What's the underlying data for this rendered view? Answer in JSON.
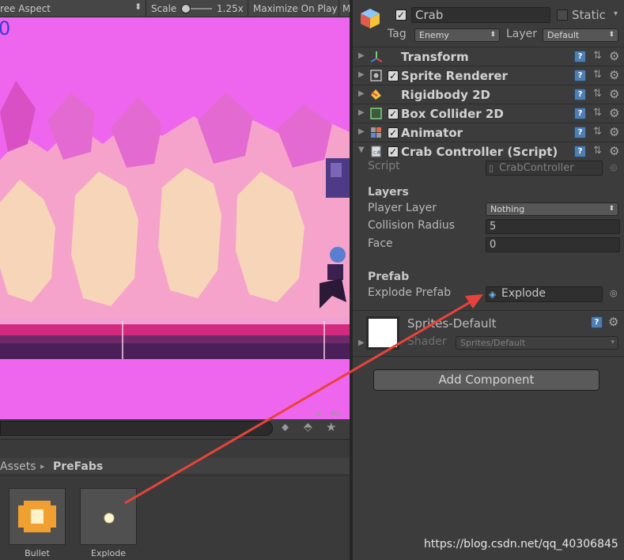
{
  "game_view": {
    "aspect_label": "ree Aspect",
    "scale_label": "Scale",
    "scale_value": "1.25x",
    "maximize_label": "Maximize On Play",
    "corner_text": "0"
  },
  "project": {
    "breadcrumb_root": "Assets",
    "breadcrumb_sep": "▸",
    "breadcrumb_current": "PreFabs",
    "assets": [
      {
        "name": "Bullet"
      },
      {
        "name": "Explode"
      }
    ]
  },
  "inspector": {
    "object_name": "Crab",
    "static_label": "Static",
    "tag_label": "Tag",
    "tag_value": "Enemy",
    "layer_label": "Layer",
    "layer_value": "Default",
    "components": [
      {
        "name": "Transform"
      },
      {
        "name": "Sprite Renderer"
      },
      {
        "name": "Rigidbody 2D"
      },
      {
        "name": "Box Collider 2D"
      },
      {
        "name": "Animator"
      },
      {
        "name": "Crab Controller (Script)"
      }
    ],
    "script_label": "Script",
    "script_value": "CrabController",
    "layers_header": "Layers",
    "player_layer_label": "Player Layer",
    "player_layer_value": "Nothing",
    "collision_radius_label": "Collision Radius",
    "collision_radius_value": "5",
    "face_label": "Face",
    "face_value": "0",
    "prefab_header": "Prefab",
    "explode_prefab_label": "Explode Prefab",
    "explode_prefab_value": "Explode",
    "material_name": "Sprites-Default",
    "shader_label": "Shader",
    "shader_value": "Sprites/Default",
    "add_component_label": "Add Component"
  },
  "watermark": "https://blog.csdn.net/qq_40306845",
  "colors": {
    "game_background": "#ee66ee",
    "annotation_arrow": "#e8433a",
    "help_icon": "#4f7fb0"
  }
}
